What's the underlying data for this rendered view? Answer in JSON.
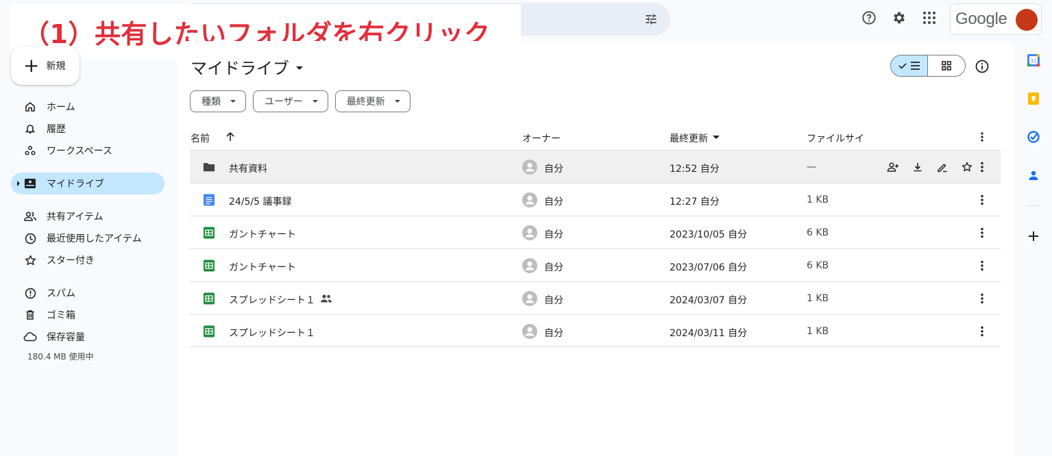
{
  "annotation": "（1）共有したいフォルダを右クリック",
  "account": {
    "brand": "Google"
  },
  "new_button": {
    "label": "新規"
  },
  "sidebar": {
    "items": [
      {
        "label": "ホーム",
        "icon": "home-icon"
      },
      {
        "label": "履歴",
        "icon": "bell-icon"
      },
      {
        "label": "ワークスペース",
        "icon": "workspace-icon"
      },
      {
        "label": "マイドライブ",
        "icon": "my-drive-icon",
        "active": true
      },
      {
        "label": "共有アイテム",
        "icon": "people-icon"
      },
      {
        "label": "最近使用したアイテム",
        "icon": "clock-icon"
      },
      {
        "label": "スター付き",
        "icon": "star-icon"
      },
      {
        "label": "スパム",
        "icon": "spam-icon"
      },
      {
        "label": "ゴミ箱",
        "icon": "trash-icon"
      },
      {
        "label": "保存容量",
        "icon": "cloud-icon"
      }
    ],
    "storage_used": "180.4 MB 使用中"
  },
  "main": {
    "title": "マイドライブ",
    "filters": [
      "種類",
      "ユーザー",
      "最終更新"
    ],
    "columns": {
      "name": "名前",
      "owner": "オーナー",
      "modified": "最終更新",
      "size": "ファイルサイ"
    },
    "rows": [
      {
        "name": "共有資料",
        "type": "folder",
        "owner": "自分",
        "modified": "12:52 自分",
        "size": "—",
        "hover": true
      },
      {
        "name": "24/5/5 議事録",
        "type": "doc",
        "owner": "自分",
        "modified": "12:27 自分",
        "size": "1 KB"
      },
      {
        "name": "ガントチャート",
        "type": "sheet",
        "owner": "自分",
        "modified": "2023/10/05 自分",
        "size": "6 KB"
      },
      {
        "name": "ガントチャート",
        "type": "sheet",
        "owner": "自分",
        "modified": "2023/07/06 自分",
        "size": "6 KB"
      },
      {
        "name": "スプレッドシート１",
        "type": "sheet",
        "owner": "自分",
        "modified": "2024/03/07 自分",
        "size": "1 KB",
        "shared": true
      },
      {
        "name": "スプレッドシート１",
        "type": "sheet",
        "owner": "自分",
        "modified": "2024/03/11 自分",
        "size": "1 KB"
      }
    ]
  },
  "colors": {
    "accent": "#c2e7ff",
    "annotation_red": "#e0303c",
    "avatar": "#c5381a",
    "sheet_green": "#1e8e3e",
    "doc_blue": "#4285f4"
  }
}
